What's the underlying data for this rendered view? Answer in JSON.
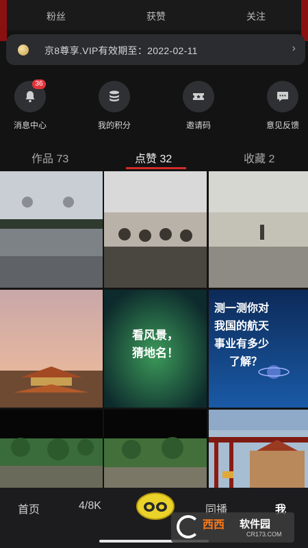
{
  "stats": [
    {
      "label": "粉丝"
    },
    {
      "label": "获赞"
    },
    {
      "label": "关注"
    }
  ],
  "vip": {
    "text": "京8尊享.VIP有效期至：2022-02-11",
    "chevron": "›"
  },
  "actions": [
    {
      "label": "消息中心",
      "icon": "bell-icon",
      "badge": "36"
    },
    {
      "label": "我的积分",
      "icon": "coin-stack-icon"
    },
    {
      "label": "邀请码",
      "icon": "ticket-icon"
    },
    {
      "label": "意见反馈",
      "icon": "chat-bubble-icon"
    }
  ],
  "tabs": [
    {
      "label": "作品 73"
    },
    {
      "label": "点赞 32",
      "active": true
    },
    {
      "label": "收藏 2"
    }
  ],
  "grid": {
    "overlay_1": "看风景，\n猜地名！",
    "overlay_2": [
      "测一测你对",
      "我国的航天",
      "事业有多少",
      "了解？"
    ]
  },
  "nav": [
    {
      "label": "首页"
    },
    {
      "label": "4/8K"
    },
    {
      "label": "同播"
    },
    {
      "label": "我",
      "active": true
    }
  ],
  "watermark": {
    "brand": "西西",
    "sub": "软件园",
    "url": "CR173.COM"
  },
  "colors": {
    "accent": "#d62b2b",
    "background": "#131313",
    "card": "#2b2c30"
  }
}
